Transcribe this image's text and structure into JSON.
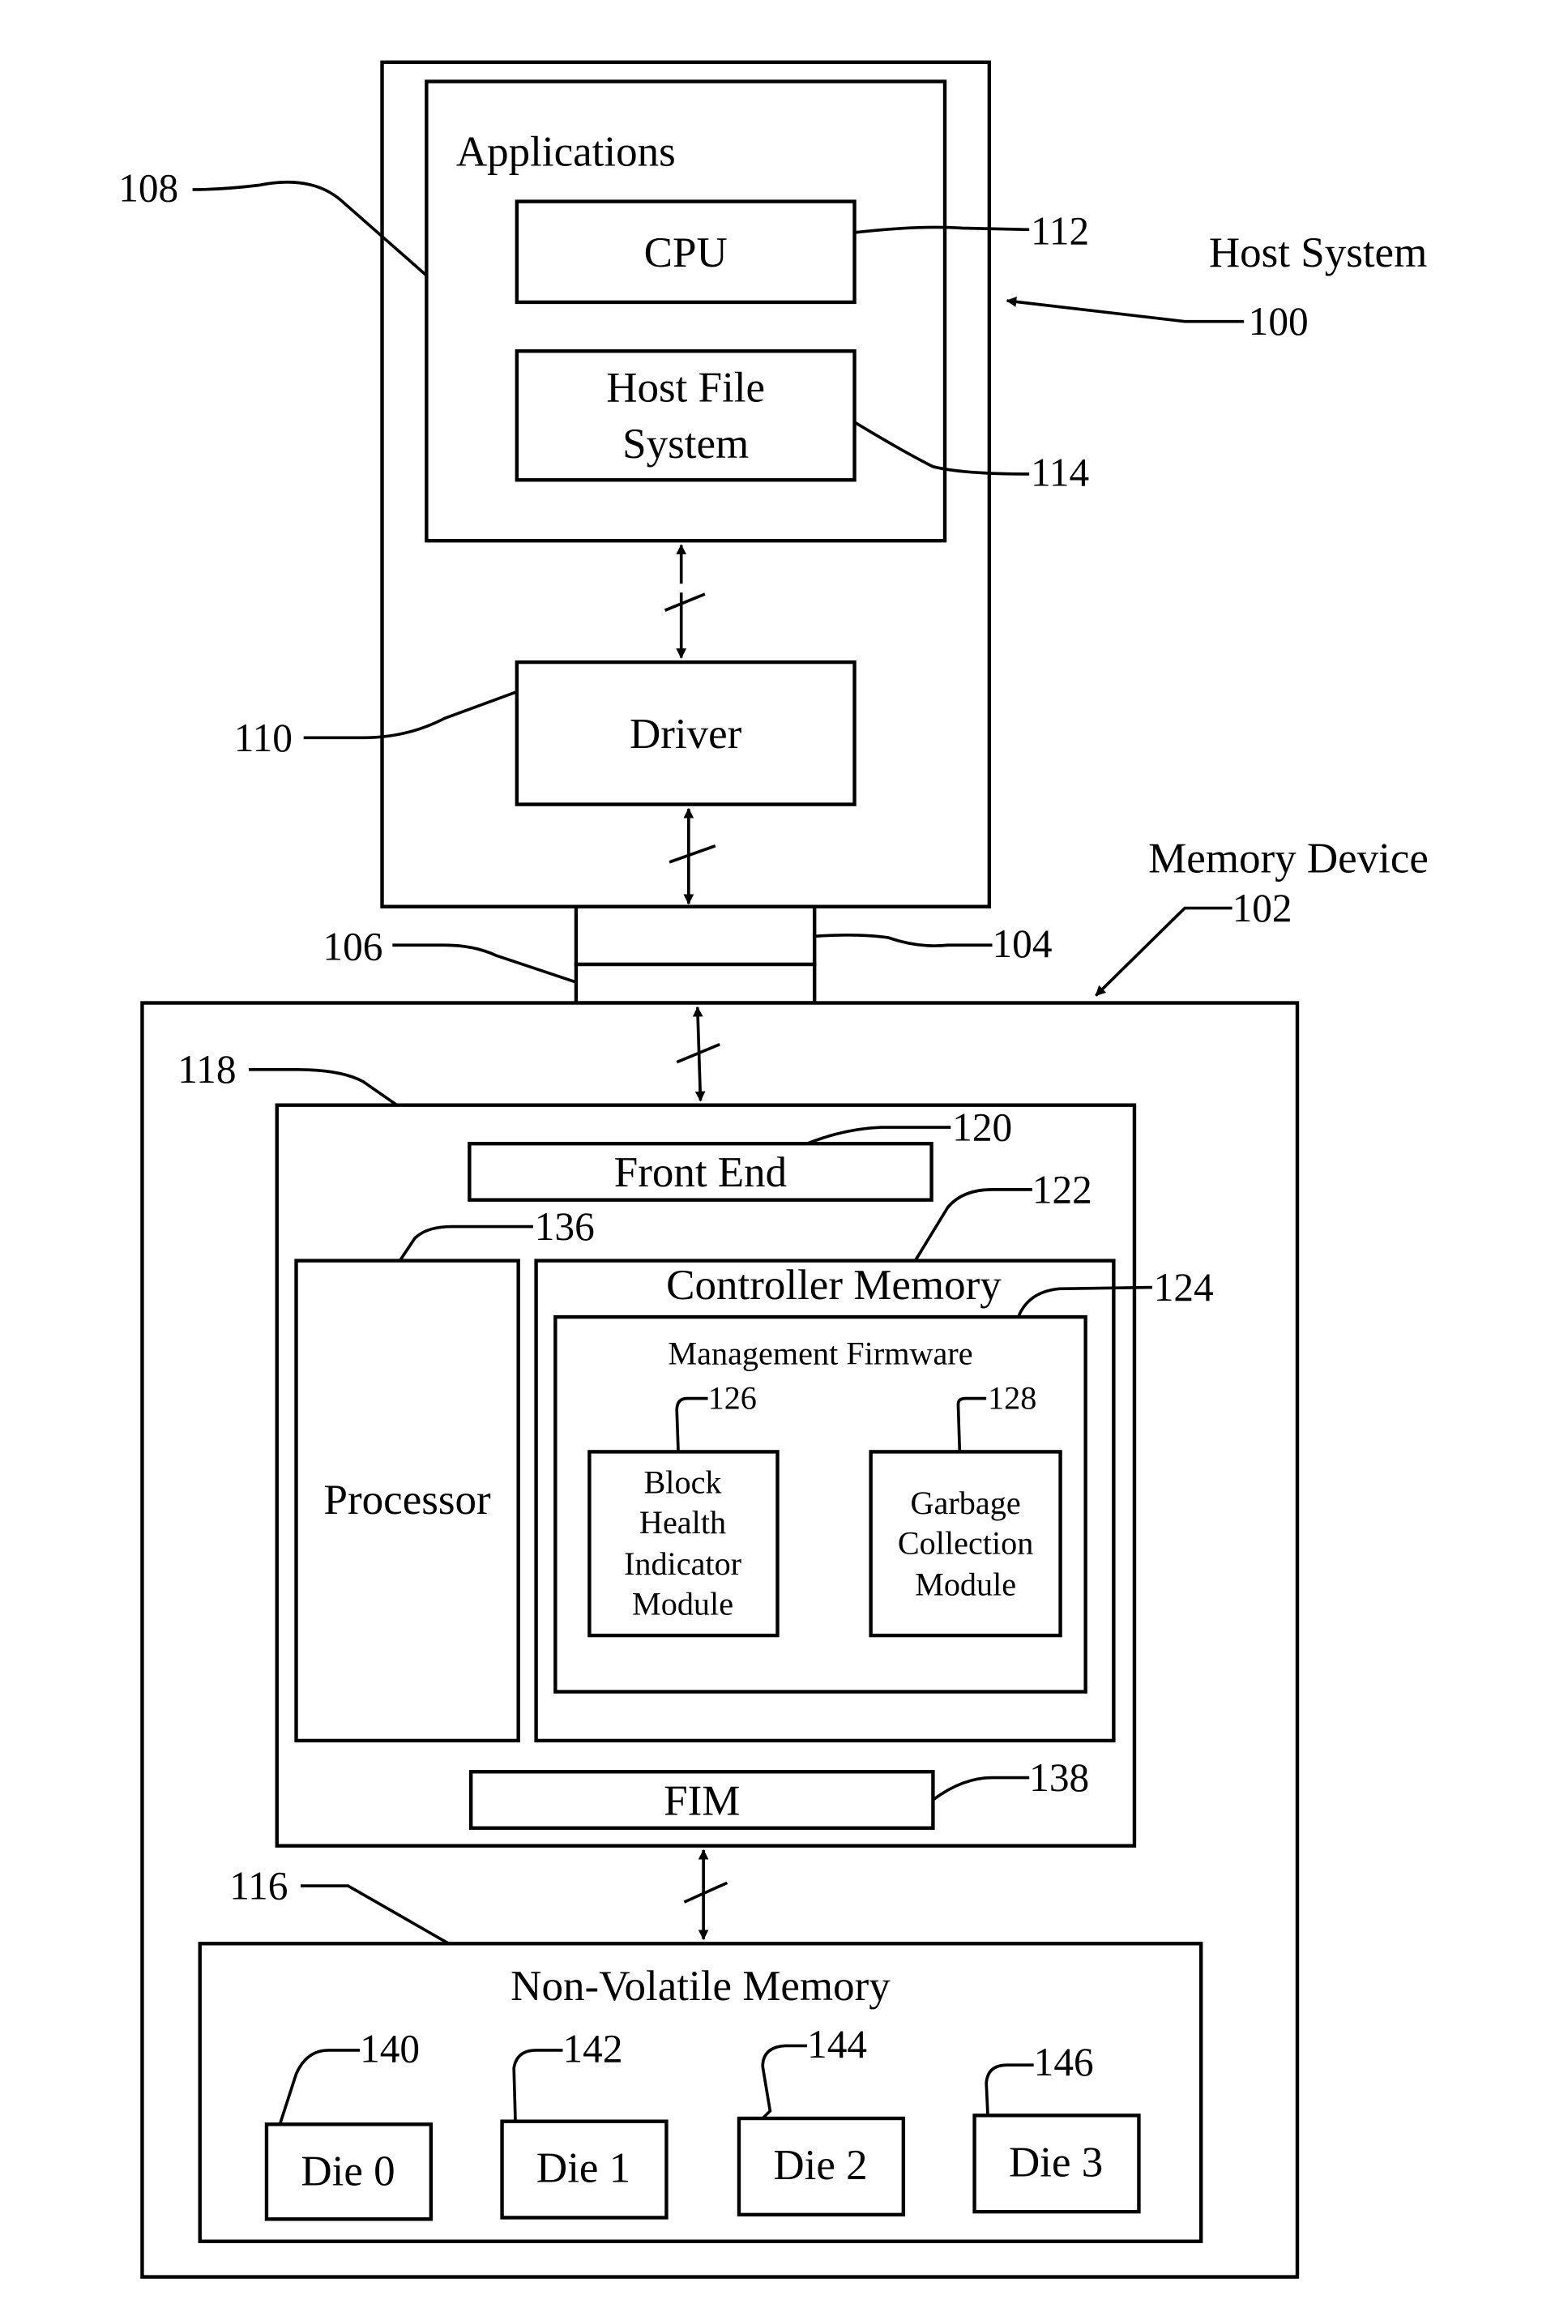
{
  "figure": {
    "host_system": {
      "label": "Host System",
      "ref": "100",
      "applications": {
        "label": "Applications",
        "ref": "108"
      },
      "cpu": {
        "label": "CPU",
        "ref": "112"
      },
      "host_file_system": {
        "label_line1": "Host File",
        "label_line2": "System",
        "ref": "114"
      },
      "driver": {
        "label": "Driver",
        "ref": "110"
      }
    },
    "interface": {
      "host_ref": "104",
      "device_ref": "106"
    },
    "memory_device": {
      "label": "Memory Device",
      "ref": "102",
      "controller": {
        "ref": "118",
        "front_end": {
          "label": "Front End",
          "ref": "120"
        },
        "processor": {
          "label": "Processor",
          "ref": "136"
        },
        "controller_memory": {
          "label": "Controller Memory",
          "ref": "122",
          "management_firmware": {
            "label": "Management Firmware",
            "ref": "124",
            "block_health": {
              "lines": [
                "Block",
                "Health",
                "Indicator",
                "Module"
              ],
              "ref": "126"
            },
            "garbage_collection": {
              "lines": [
                "Garbage",
                "Collection",
                "Module"
              ],
              "ref": "128"
            }
          }
        },
        "fim": {
          "label": "FIM",
          "ref": "138"
        }
      },
      "nvm": {
        "label": "Non-Volatile Memory",
        "ref": "116",
        "dies": [
          {
            "label": "Die 0",
            "ref": "140"
          },
          {
            "label": "Die 1",
            "ref": "142"
          },
          {
            "label": "Die 2",
            "ref": "144"
          },
          {
            "label": "Die 3",
            "ref": "146"
          }
        ]
      }
    }
  }
}
